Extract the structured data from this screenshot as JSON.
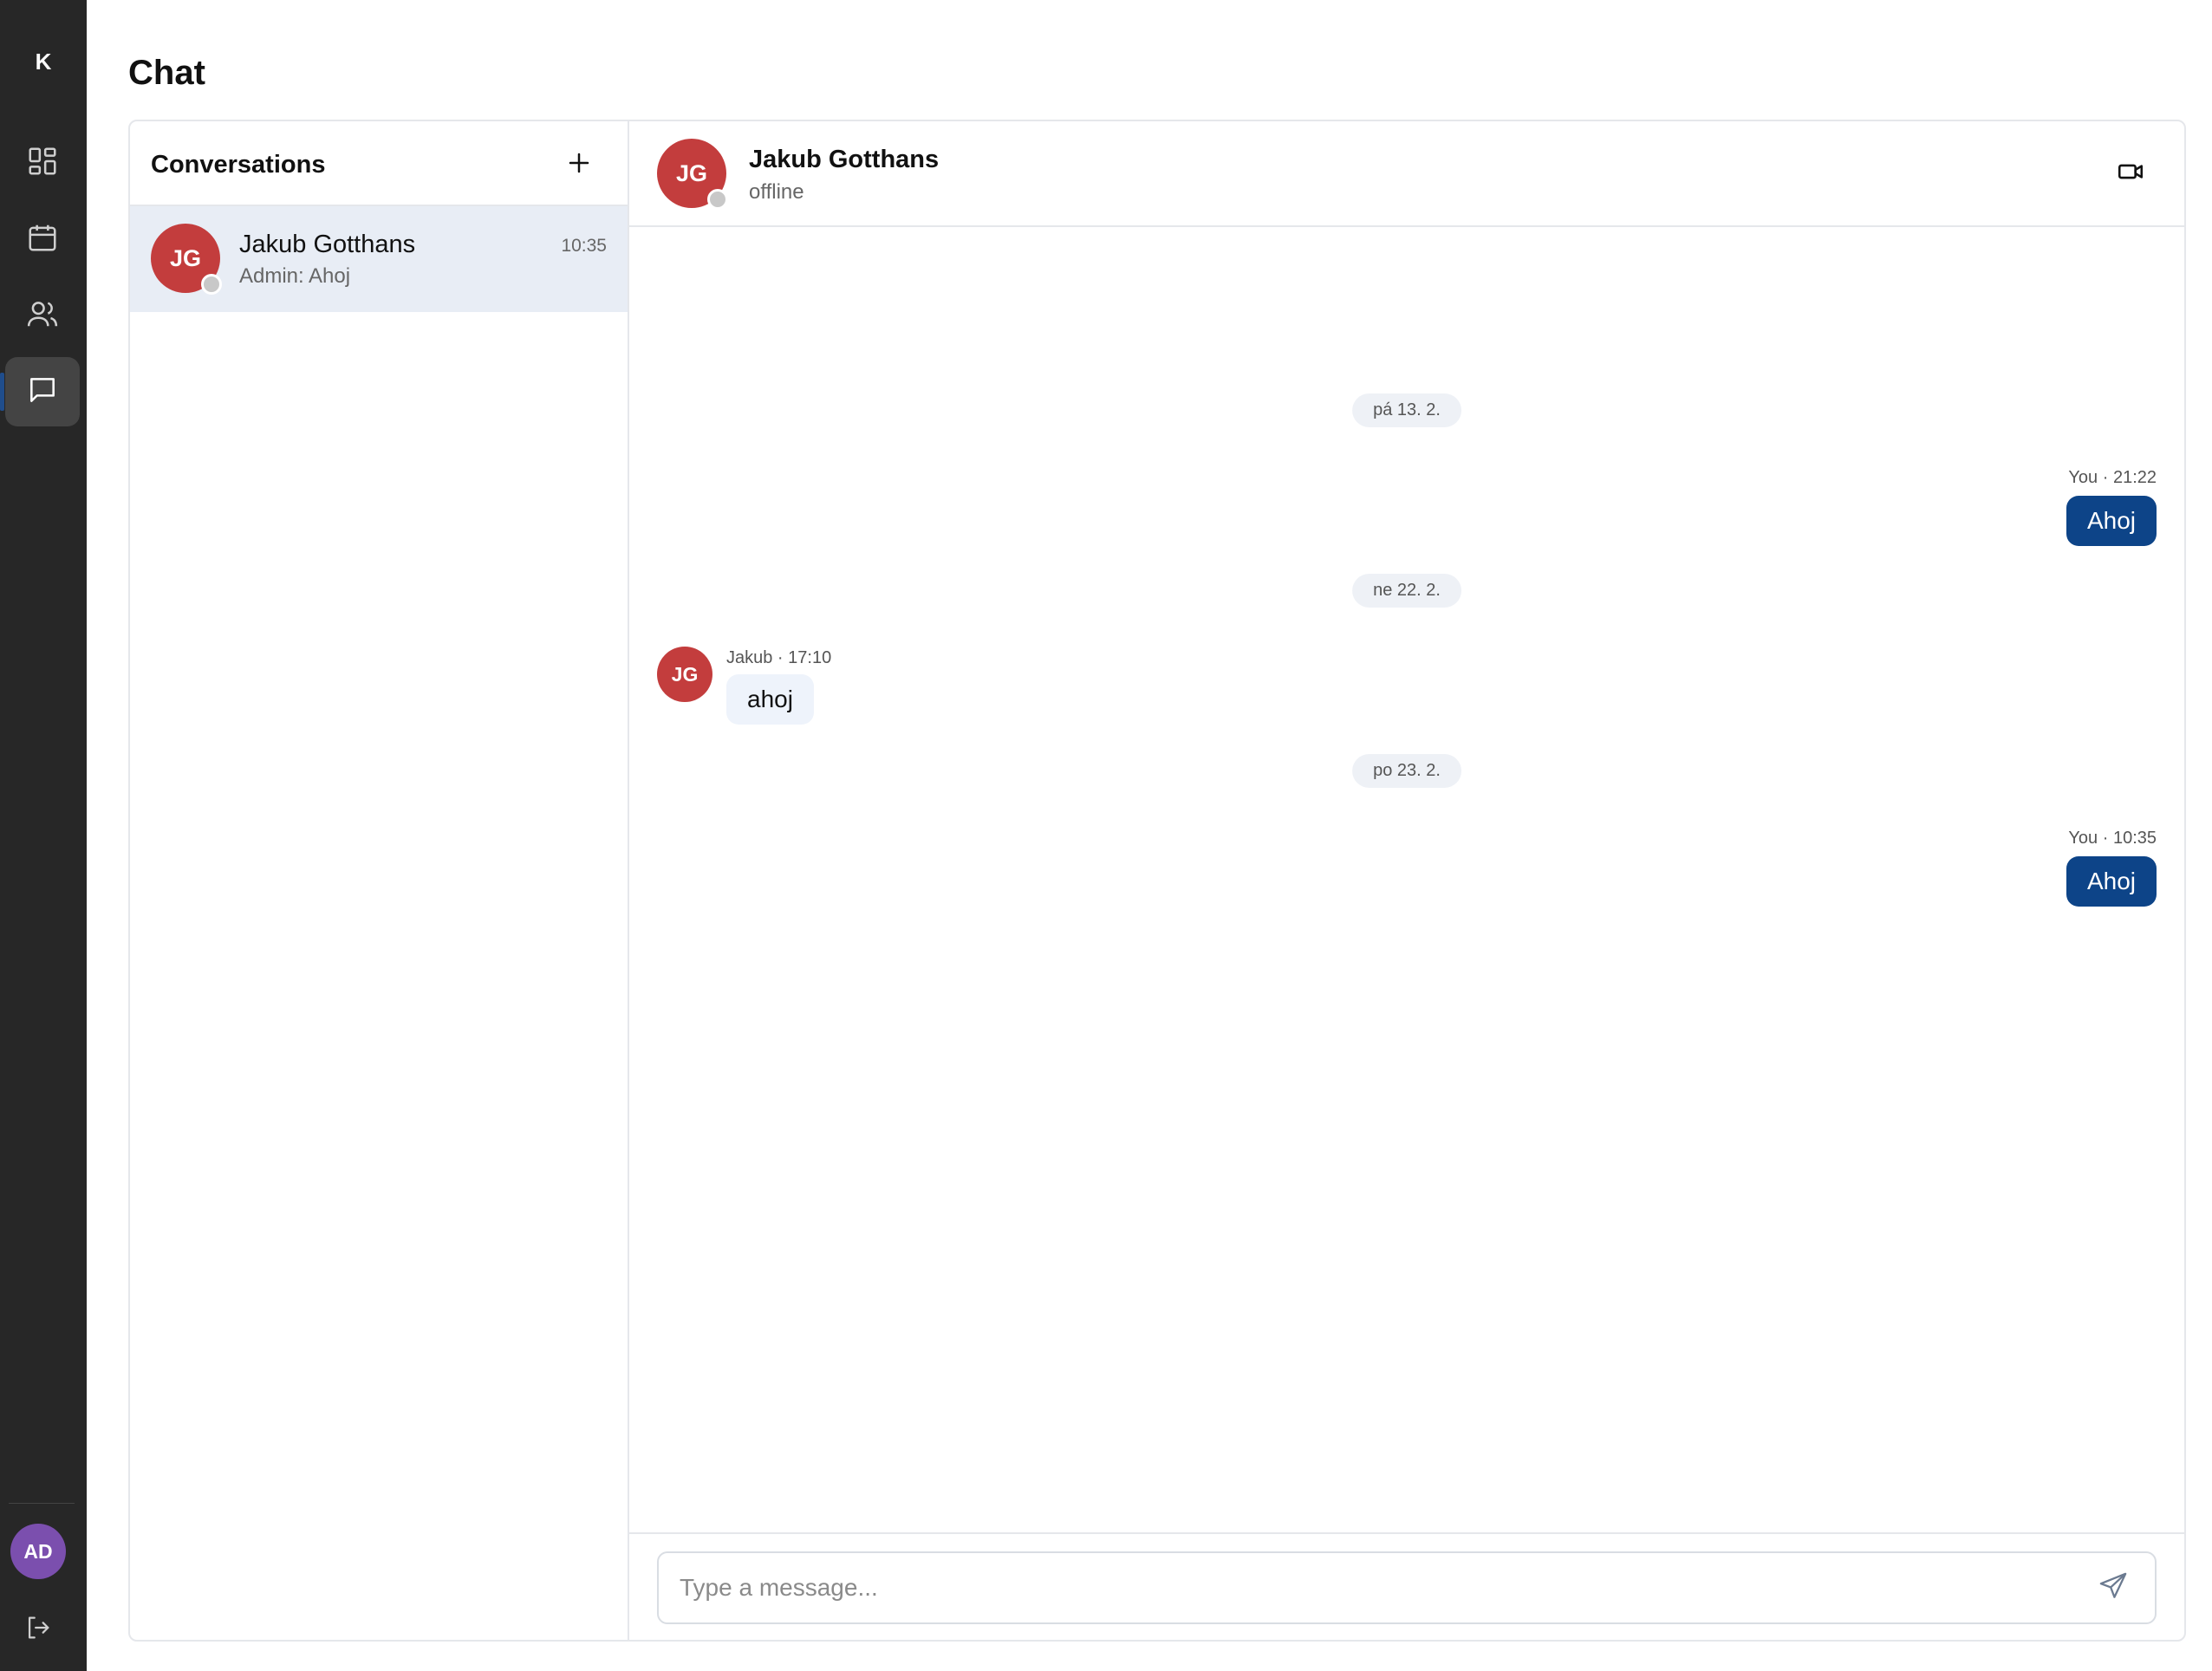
{
  "app": {
    "logo_letter": "K",
    "page_title": "Chat"
  },
  "sidebar": {
    "items": [
      {
        "name": "dashboard",
        "icon": "dashboard-icon"
      },
      {
        "name": "calendar",
        "icon": "calendar-icon"
      },
      {
        "name": "users",
        "icon": "users-icon"
      },
      {
        "name": "chat",
        "icon": "chat-icon",
        "active": true
      }
    ],
    "user_initials": "AD",
    "logout_icon": "logout-icon"
  },
  "conversations": {
    "title": "Conversations",
    "add_icon": "plus-icon",
    "items": [
      {
        "initials": "JG",
        "name": "Jakub Gotthans",
        "preview": "Admin: Ahoj",
        "time": "10:35",
        "status": "offline"
      }
    ]
  },
  "chat": {
    "contact_initials": "JG",
    "contact_name": "Jakub Gotthans",
    "contact_status": "offline",
    "video_icon": "video-icon",
    "dates": [
      "pá 13. 2.",
      "ne 22. 2.",
      "po 23. 2."
    ],
    "messages": [
      {
        "direction": "out",
        "meta": "You · 21:22",
        "text": "Ahoj"
      },
      {
        "direction": "in",
        "initials": "JG",
        "meta": "Jakub · 17:10",
        "text": "ahoj"
      },
      {
        "direction": "out",
        "meta": "You · 10:35",
        "text": "Ahoj"
      }
    ],
    "composer_placeholder": "Type a message...",
    "send_icon": "send-icon"
  },
  "colors": {
    "rail_bg": "#272727",
    "accent": "#0d4488",
    "avatar_contact": "#c33d3d",
    "avatar_user": "#7b4fae",
    "selected_row": "#e8edf5"
  }
}
